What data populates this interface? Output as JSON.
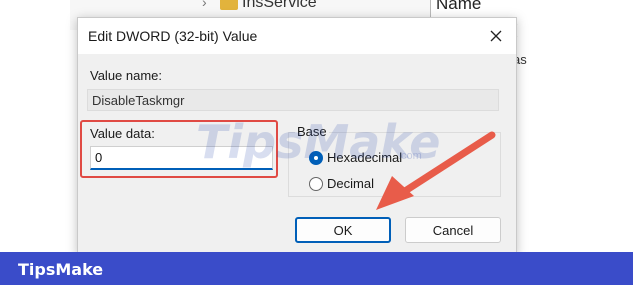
{
  "background": {
    "tree_item": "InsService",
    "list_header": "Name",
    "partial_text_1": "(",
    "partial_text_2": "as"
  },
  "dialog": {
    "title": "Edit DWORD (32-bit) Value",
    "value_name_label": "Value name:",
    "value_name": "DisableTaskmgr",
    "value_data_label": "Value data:",
    "value_data": "0",
    "base_label": "Base",
    "radio_hex_label": "Hexadecimal",
    "radio_dec_label": "Decimal",
    "ok_label": "OK",
    "cancel_label": "Cancel"
  },
  "watermark": {
    "text": "TipsMake",
    "sub": ".com"
  },
  "footer": {
    "brand": "TipsMake",
    "color": "#3a4cc9"
  },
  "colors": {
    "accent": "#005fb8",
    "highlight": "#e04a44",
    "arrow": "#e85c4a"
  },
  "icons": {
    "close": "close-icon",
    "folder": "folder-icon",
    "chevron": "chevron-right-icon"
  }
}
